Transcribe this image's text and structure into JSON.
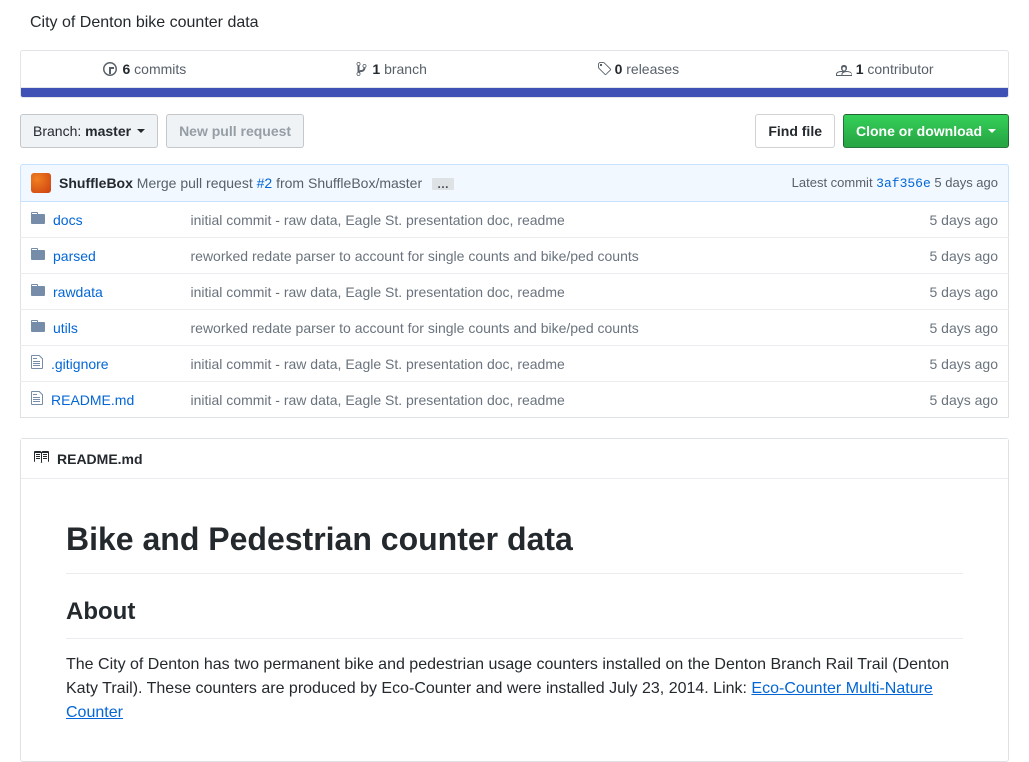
{
  "description": "City of Denton bike counter data",
  "stats": {
    "commits_count": "6",
    "commits_label": "commits",
    "branches_count": "1",
    "branches_label": "branch",
    "releases_count": "0",
    "releases_label": "releases",
    "contributors_count": "1",
    "contributors_label": "contributor"
  },
  "toolbar": {
    "branch_prefix": "Branch:",
    "branch_name": "master",
    "new_pr": "New pull request",
    "find_file": "Find file",
    "clone": "Clone or download"
  },
  "latest_commit": {
    "author": "ShuffleBox",
    "message_a": "Merge pull request ",
    "pr": "#2",
    "message_b": " from ShuffleBox/master",
    "ellipsis": "…",
    "prefix": "Latest commit ",
    "sha": "3af356e",
    "age": " 5 days ago"
  },
  "files": [
    {
      "type": "dir",
      "name": "docs",
      "msg": "initial commit - raw data, Eagle St. presentation doc, readme",
      "age": "5 days ago"
    },
    {
      "type": "dir",
      "name": "parsed",
      "msg": "reworked redate parser to account for single counts and bike/ped counts",
      "age": "5 days ago"
    },
    {
      "type": "dir",
      "name": "rawdata",
      "msg": "initial commit - raw data, Eagle St. presentation doc, readme",
      "age": "5 days ago"
    },
    {
      "type": "dir",
      "name": "utils",
      "msg": "reworked redate parser to account for single counts and bike/ped counts",
      "age": "5 days ago"
    },
    {
      "type": "file",
      "name": ".gitignore",
      "msg": "initial commit - raw data, Eagle St. presentation doc, readme",
      "age": "5 days ago"
    },
    {
      "type": "file",
      "name": "README.md",
      "msg": "initial commit - raw data, Eagle St. presentation doc, readme",
      "age": "5 days ago"
    }
  ],
  "readme": {
    "filename": "README.md",
    "h1": "Bike and Pedestrian counter data",
    "h2": "About",
    "p1a": "The City of Denton has two permanent bike and pedestrian usage counters installed on the Denton Branch Rail Trail (Denton Katy Trail). These counters are produced by Eco-Counter and were installed July 23, 2014. Link: ",
    "p1link": "Eco-Counter Multi-Nature Counter"
  }
}
